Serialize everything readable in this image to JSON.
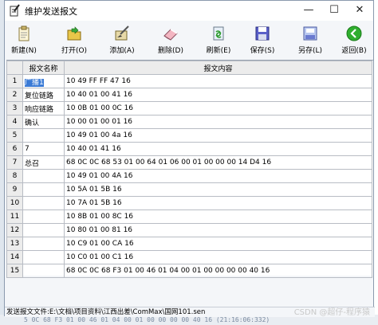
{
  "window": {
    "title": "维护发送报文",
    "minimize": "—",
    "maximize": "☐",
    "close": "✕"
  },
  "toolbar": [
    {
      "label": "新建(N)",
      "icon": "new-document-icon"
    },
    {
      "label": "打开(O)",
      "icon": "open-folder-icon"
    },
    {
      "label": "添加(A)",
      "icon": "add-icon"
    },
    {
      "label": "删除(D)",
      "icon": "eraser-icon"
    },
    {
      "label": "刷新(E)",
      "icon": "refresh-icon"
    },
    {
      "label": "保存(S)",
      "icon": "floppy-disk-icon"
    },
    {
      "label": "另存(L)",
      "icon": "save-as-icon"
    },
    {
      "label": "返回(B)",
      "icon": "back-arrow-icon"
    }
  ],
  "table": {
    "headers": [
      "报文名称",
      "报文内容"
    ],
    "rows": [
      {
        "num": "1",
        "name": "广播1",
        "content": "10 49 FF FF 47 16",
        "selected": true
      },
      {
        "num": "2",
        "name": "复位链路",
        "content": "10 40 01 00 41 16"
      },
      {
        "num": "3",
        "name": "响应链路",
        "content": "10 0B 01 00 0C 16"
      },
      {
        "num": "4",
        "name": "确认",
        "content": "10 00 01 00 01 16"
      },
      {
        "num": "5",
        "name": "",
        "content": "10 49 01 00 4a 16"
      },
      {
        "num": "6",
        "name": "7",
        "content": "10 40 01 41 16"
      },
      {
        "num": "7",
        "name": "总召",
        "content": "68 0C 0C 68 53 01 00 64 01 06 00 01 00 00 00 14 D4 16"
      },
      {
        "num": "8",
        "name": "",
        "content": "10 49 01 00 4A 16"
      },
      {
        "num": "9",
        "name": "",
        "content": "10 5A 01 5B 16"
      },
      {
        "num": "10",
        "name": "",
        "content": "10 7A 01 5B 16"
      },
      {
        "num": "11",
        "name": "",
        "content": "10 8B 01 00 8C 16"
      },
      {
        "num": "12",
        "name": "",
        "content": "10 80 01 00 81 16"
      },
      {
        "num": "13",
        "name": "",
        "content": "10 C9 01 00 CA 16"
      },
      {
        "num": "14",
        "name": "",
        "content": "10 C0 01 00 C1 16"
      },
      {
        "num": "15",
        "name": "",
        "content": "68 0C 0C 68 F3 01 00 46 01 04 00 01 00 00 00 00 40 16"
      }
    ]
  },
  "status": {
    "file_path": "发送报文文件:E:\\文档\\项目资料\\江西出差\\ComMax\\国网101.sen"
  },
  "background_text": "5 0C 68 F3 01 00 46 01 04 00 01 00 00 00 00 40 16 (21:16:06:332)",
  "watermark": "CSDN @超仔-程序猿"
}
